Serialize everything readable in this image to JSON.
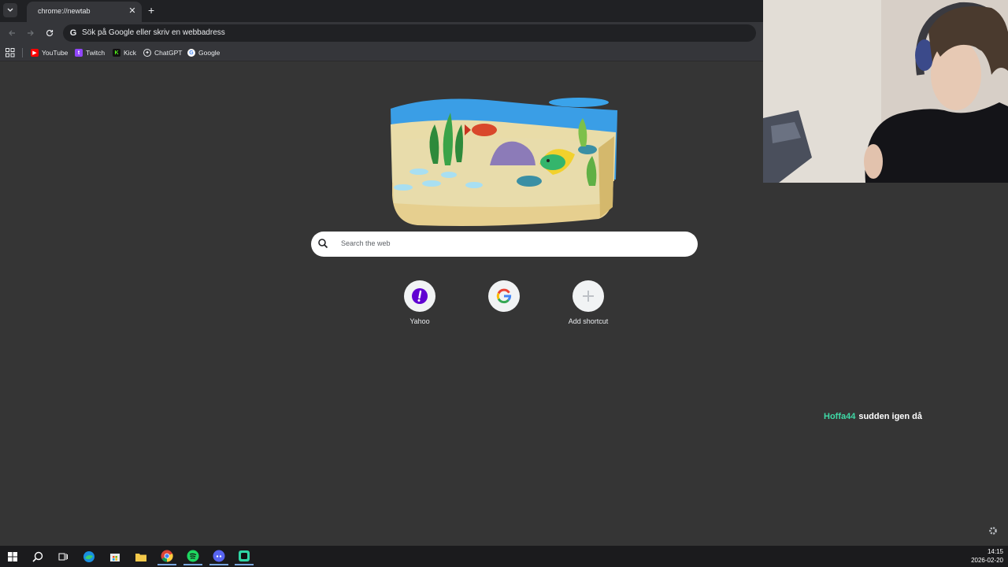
{
  "browser": {
    "tab_title": "chrome://newtab",
    "omnibox_text": "Sök på Google eller skriv en webbadress"
  },
  "bookmarks": [
    {
      "label": "YouTube",
      "icon": "youtube-icon",
      "color": "#ff0000"
    },
    {
      "label": "Twitch",
      "icon": "twitch-icon",
      "color": "#9146ff"
    },
    {
      "label": "Kick",
      "icon": "kick-icon",
      "color": "#53fc18"
    },
    {
      "label": "ChatGPT",
      "icon": "chatgpt-icon",
      "color": "#e8eaed"
    },
    {
      "label": "Google",
      "icon": "google-icon",
      "color": "#4285f4"
    }
  ],
  "ntp": {
    "search_placeholder": "Search the web",
    "shortcuts": [
      {
        "label": "Yahoo",
        "icon": "yahoo-icon"
      },
      {
        "label": "",
        "icon": "google-icon"
      },
      {
        "label": "Add shortcut",
        "icon": "plus-icon"
      }
    ]
  },
  "chat": {
    "user": "Hoffa44",
    "message": "sudden igen då",
    "user_color": "#3fd9a6"
  },
  "taskbar": {
    "items": [
      "start-icon",
      "search-icon",
      "task-view-icon",
      "edge-icon",
      "store-icon",
      "file-explorer-icon",
      "chrome-icon",
      "spotify-icon",
      "discord-icon",
      "app-icon"
    ],
    "time": "14:15",
    "date": "2026-02-20"
  }
}
